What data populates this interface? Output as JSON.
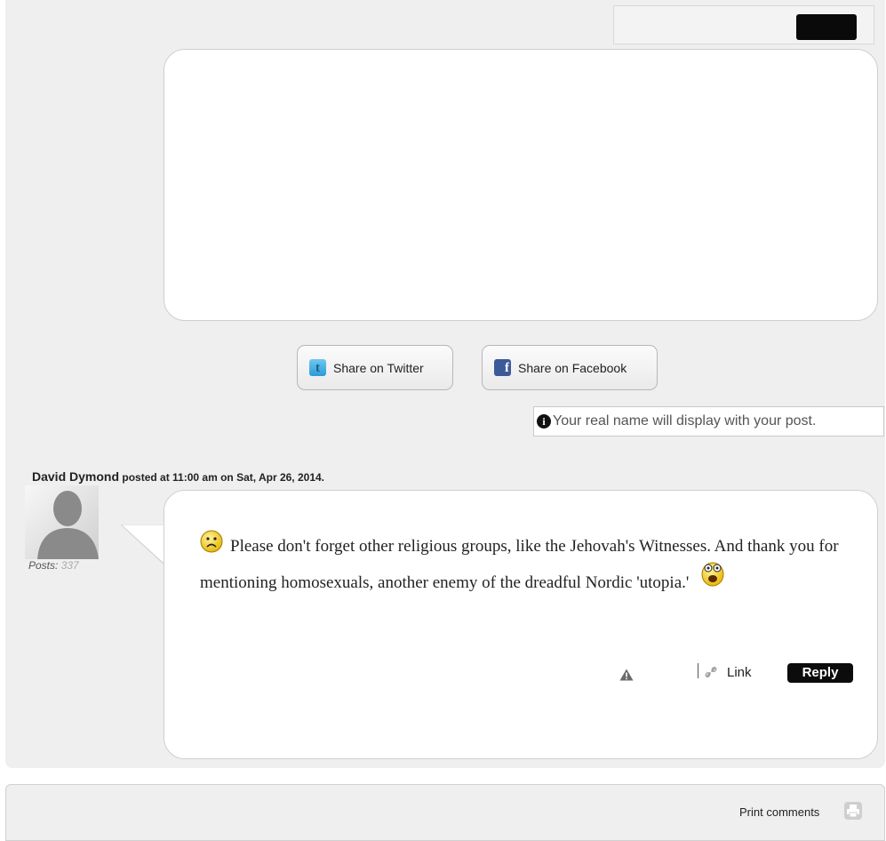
{
  "share": {
    "twitter_label": "Share on Twitter",
    "twitter_icon": "twitter-icon",
    "facebook_label": "Share on Facebook",
    "facebook_icon": "facebook-icon"
  },
  "notice": {
    "icon": "info-icon",
    "text": "Your real name will display with your post."
  },
  "comment": {
    "author": "David Dymond",
    "posted_meta": "posted at 11:00 am on Sat, Apr 26, 2014.",
    "posts_label": "Posts:",
    "posts_count": "337",
    "text_part1": "Please don't forget other religious groups, like the Jehovah's Witnesses. And thank you for mentioning homosexuals, another enemy of the dreadful Nordic 'utopia.'",
    "actions": {
      "report_icon": "warning-icon",
      "link_icon": "link-icon",
      "link_label": "Link",
      "reply_label": "Reply"
    }
  },
  "footer": {
    "print_label": "Print comments",
    "print_icon": "printer-icon"
  },
  "colors": {
    "panel_bg": "#efefef",
    "button_dark": "#0a0a0a",
    "twitter": "#2b9bd6",
    "facebook": "#3b5a9a"
  }
}
